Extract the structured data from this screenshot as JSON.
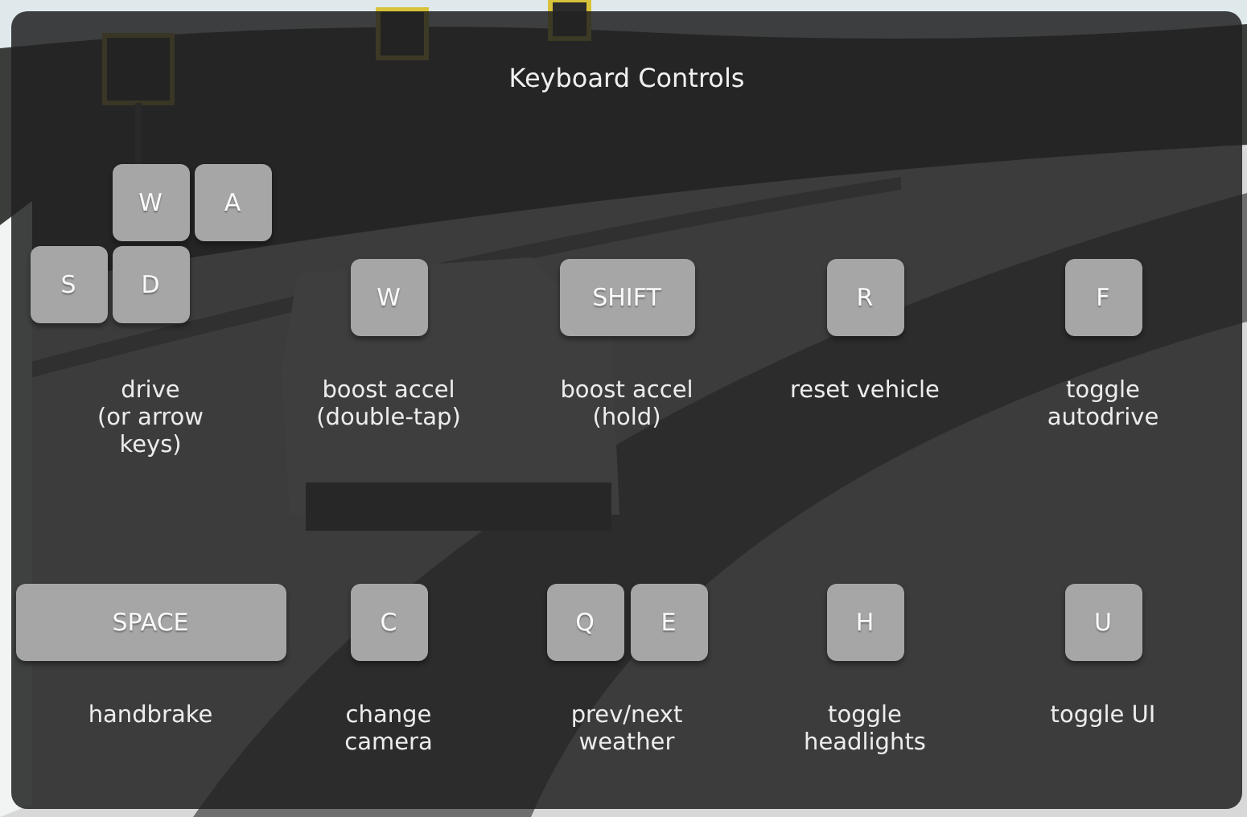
{
  "panel": {
    "title": "Keyboard Controls"
  },
  "rows": [
    {
      "controls": [
        {
          "kind": "wasd",
          "keys": [
            {
              "label": "W",
              "kind": "letter"
            },
            {
              "label": "A",
              "kind": "letter"
            },
            {
              "label": "S",
              "kind": "letter"
            },
            {
              "label": "D",
              "kind": "letter"
            }
          ],
          "description": "drive\n(or arrow\nkeys)"
        },
        {
          "kind": "keys",
          "keys": [
            {
              "label": "W",
              "kind": "letter"
            }
          ],
          "description": "boost accel\n(double-tap)"
        },
        {
          "kind": "keys",
          "keys": [
            {
              "label": "SHIFT",
              "kind": "modifier"
            }
          ],
          "description": "boost accel\n(hold)"
        },
        {
          "kind": "keys",
          "keys": [
            {
              "label": "R",
              "kind": "letter"
            }
          ],
          "description": "reset vehicle"
        },
        {
          "kind": "keys",
          "keys": [
            {
              "label": "F",
              "kind": "letter"
            }
          ],
          "description": "toggle\nautodrive"
        }
      ]
    },
    {
      "controls": [
        {
          "kind": "keys",
          "keys": [
            {
              "label": "SPACE",
              "kind": "spacebar"
            }
          ],
          "description": "handbrake"
        },
        {
          "kind": "keys",
          "keys": [
            {
              "label": "C",
              "kind": "letter"
            }
          ],
          "description": "change\ncamera"
        },
        {
          "kind": "keys",
          "keys": [
            {
              "label": "Q",
              "kind": "letter"
            },
            {
              "label": "E",
              "kind": "letter"
            }
          ],
          "description": "prev/next\nweather"
        },
        {
          "kind": "keys",
          "keys": [
            {
              "label": "H",
              "kind": "letter"
            }
          ],
          "description": "toggle\nheadlights"
        },
        {
          "kind": "keys",
          "keys": [
            {
              "label": "U",
              "kind": "letter"
            }
          ],
          "description": "toggle UI"
        }
      ]
    }
  ]
}
